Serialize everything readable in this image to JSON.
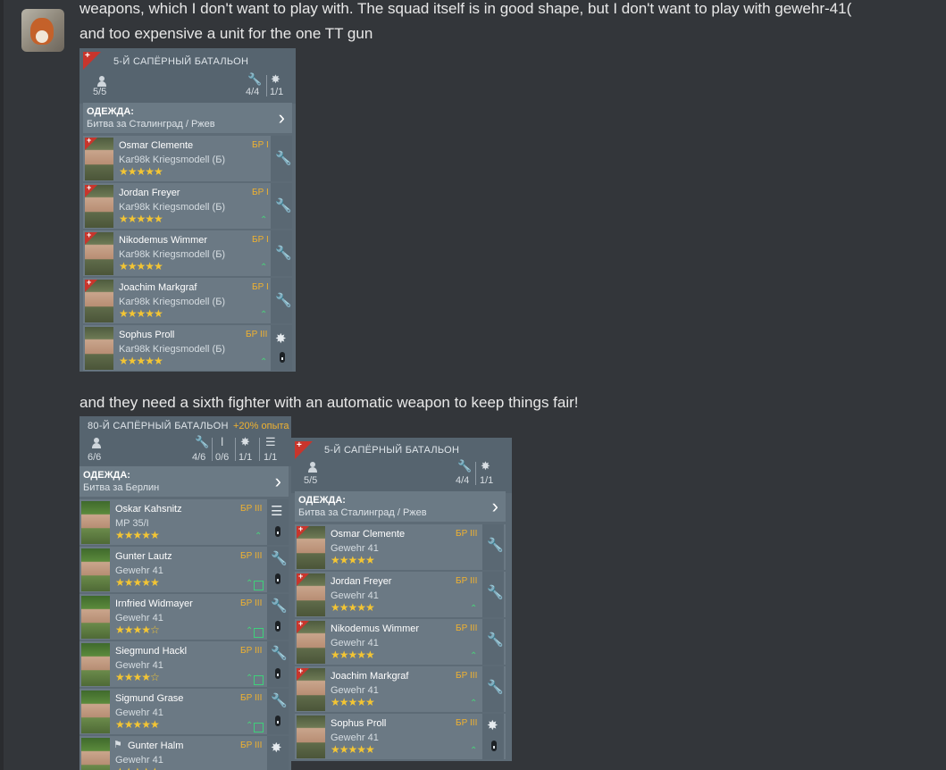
{
  "post": {
    "avatar_alt": "fox avatar",
    "text_line1": "weapons, which I don't want to play with. The squad itself is in good shape, but I don't want to play with gewehr-41(",
    "text_line2": "and too expensive a unit for the one TT gun",
    "text_line3": "and they need a sixth fighter with an automatic weapon to keep things fair!"
  },
  "screens": [
    {
      "squad_name": "5-Й САПЁРНЫЙ БАТАЛЬОН",
      "soldiers_count": "5/5",
      "engineers_count": "4/4",
      "flamers_count": "1/1",
      "outfit_label": "ОДЕЖДА:",
      "outfit_value": "Битва за Сталинград / Ржев",
      "soldiers": [
        {
          "name": "Osmar Clemente",
          "weapon": "Kar98k Kriegsmodell (Б)",
          "br": "БР I",
          "stars": "★★★★★"
        },
        {
          "name": "Jordan Freyer",
          "weapon": "Kar98k Kriegsmodell (Б)",
          "br": "БР I",
          "stars": "★★★★★"
        },
        {
          "name": "Nikodemus Wimmer",
          "weapon": "Kar98k Kriegsmodell (Б)",
          "br": "БР I",
          "stars": "★★★★★"
        },
        {
          "name": "Joachim Markgraf",
          "weapon": "Kar98k Kriegsmodell (Б)",
          "br": "БР I",
          "stars": "★★★★★"
        },
        {
          "name": "Sophus Proll",
          "weapon": "Kar98k Kriegsmodell (Б)",
          "br": "БР III",
          "stars": "★★★★★"
        }
      ]
    },
    {
      "squad_name": "80-Й САПЁРНЫЙ БАТАЛЬОН",
      "xp_bonus": "+20% опыта",
      "soldiers_count": "6/6",
      "engineers_count": "4/6",
      "machinegunners_count": "0/6",
      "flamers_count": "1/1",
      "radio_count": "1/1",
      "outfit_label": "ОДЕЖДА:",
      "outfit_value": "Битва за Берлин",
      "soldiers": [
        {
          "name": "Oskar Kahsnitz",
          "weapon": "MP 35/I",
          "br": "БР III",
          "stars": "★★★★★"
        },
        {
          "name": "Gunter Lautz",
          "weapon": "Gewehr 41",
          "br": "БР III",
          "stars": "★★★★★"
        },
        {
          "name": "Irnfried Widmayer",
          "weapon": "Gewehr 41",
          "br": "БР III",
          "stars": "★★★★☆"
        },
        {
          "name": "Siegmund Hackl",
          "weapon": "Gewehr 41",
          "br": "БР III",
          "stars": "★★★★☆"
        },
        {
          "name": "Sigmund Grase",
          "weapon": "Gewehr 41",
          "br": "БР III",
          "stars": "★★★★★"
        },
        {
          "name": "Gunter Halm",
          "weapon": "Gewehr 41",
          "br": "БР III",
          "stars": "★★★★★"
        }
      ]
    },
    {
      "squad_name": "5-Й САПЁРНЫЙ БАТАЛЬОН",
      "soldiers_count": "5/5",
      "engineers_count": "4/4",
      "flamers_count": "1/1",
      "outfit_label": "ОДЕЖДА:",
      "outfit_value": "Битва за Сталинград / Ржев",
      "soldiers": [
        {
          "name": "Osmar Clemente",
          "weapon": "Gewehr 41",
          "br": "БР III",
          "stars": "★★★★★"
        },
        {
          "name": "Jordan Freyer",
          "weapon": "Gewehr 41",
          "br": "БР III",
          "stars": "★★★★★"
        },
        {
          "name": "Nikodemus Wimmer",
          "weapon": "Gewehr 41",
          "br": "БР III",
          "stars": "★★★★★"
        },
        {
          "name": "Joachim Markgraf",
          "weapon": "Gewehr 41",
          "br": "БР III",
          "stars": "★★★★★"
        },
        {
          "name": "Sophus Proll",
          "weapon": "Gewehr 41",
          "br": "БР III",
          "stars": "★★★★★"
        }
      ]
    }
  ],
  "icons": {
    "wrench": "🔧",
    "flame": "✸",
    "chevron": "›",
    "up": "⌃"
  }
}
